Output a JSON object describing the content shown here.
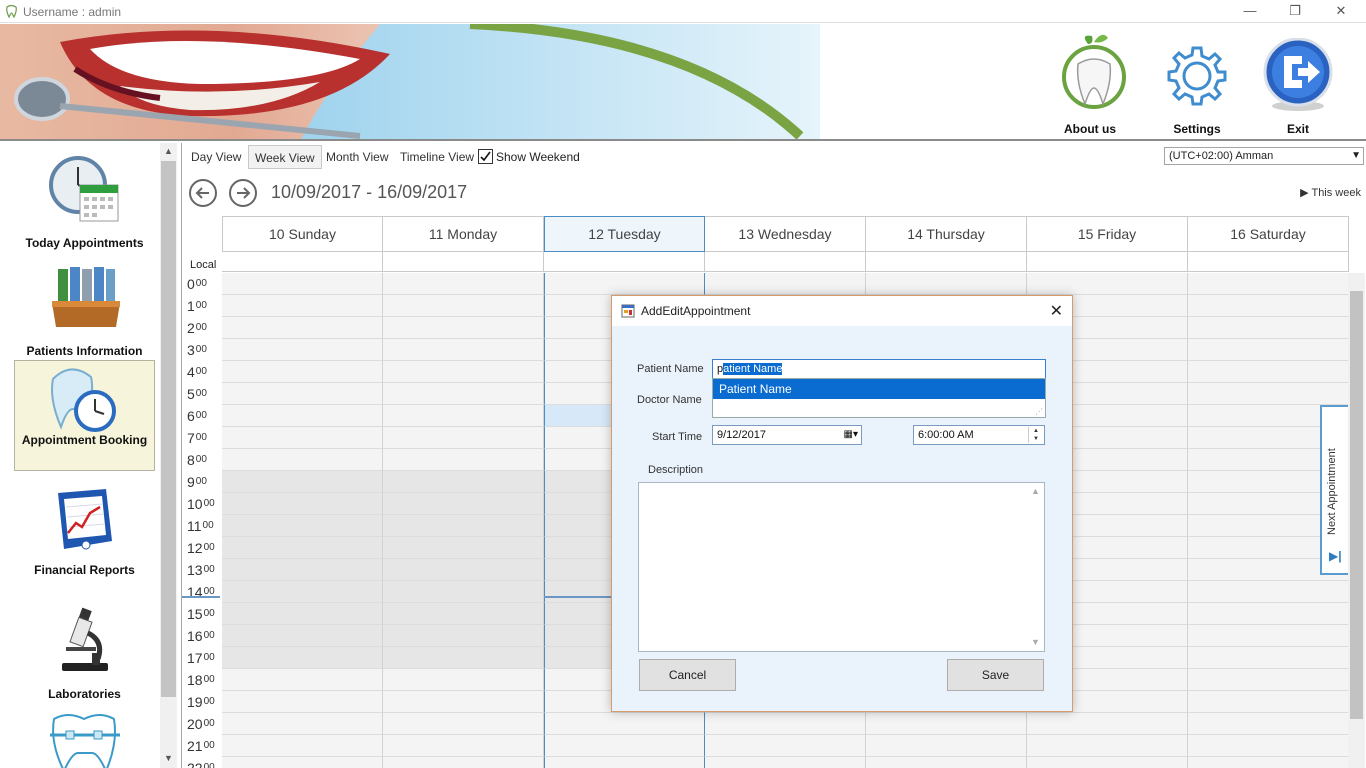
{
  "window": {
    "title": "Username : admin",
    "controls": [
      "—",
      "❐",
      "✕"
    ]
  },
  "header": {
    "buttons": [
      {
        "id": "about",
        "label": "About us",
        "icon": "tooth-leaf-icon"
      },
      {
        "id": "settings",
        "label": "Settings",
        "icon": "gear-icon"
      },
      {
        "id": "exit",
        "label": "Exit",
        "icon": "exit-icon"
      }
    ]
  },
  "sidebar": {
    "items": [
      {
        "label": "Today Appointments",
        "icon": "clock-calendar-icon"
      },
      {
        "label": "Patients Information",
        "icon": "binders-icon"
      },
      {
        "label": "Appointment Booking",
        "icon": "tooth-clock-icon",
        "active": true
      },
      {
        "label": "Financial Reports",
        "icon": "chart-book-icon"
      },
      {
        "label": "Laboratories",
        "icon": "microscope-icon"
      },
      {
        "label": "",
        "icon": "braces-tooth-icon"
      }
    ]
  },
  "scheduler": {
    "views": [
      "Day View",
      "Week View",
      "Month View",
      "Timeline View"
    ],
    "active_view": "Week View",
    "show_weekend_label": "Show Weekend",
    "show_weekend_checked": true,
    "timezone": "(UTC+02:00) Amman",
    "date_range": "10/09/2017 - 16/09/2017",
    "this_week_label": "▶ This week",
    "local_label": "Local",
    "days": [
      "10 Sunday",
      "11 Monday",
      "12 Tuesday",
      "13 Wednesday",
      "14 Thursday",
      "15 Friday",
      "16 Saturday"
    ],
    "today_index": 2,
    "hours": [
      "0",
      "1",
      "2",
      "3",
      "4",
      "5",
      "6",
      "7",
      "8",
      "9",
      "10",
      "11",
      "12",
      "13",
      "14",
      "15",
      "16",
      "17",
      "18",
      "19",
      "20",
      "21",
      "22"
    ],
    "minutes": "00",
    "next_appointment_label": "Next Appointment",
    "colors": {
      "accent": "#4a8cc4",
      "selected": "#d7e9f8"
    }
  },
  "dialog": {
    "title": "AddEditAppointment",
    "patient_label": "Patient Name",
    "patient_value_typed": "p",
    "patient_value_suggest": "atient   Name",
    "autocomplete_option": "Patient   Name",
    "doctor_label": "Doctor Name",
    "start_label": "Start Time",
    "start_date": "9/12/2017",
    "start_time": "6:00:00 AM",
    "description_label": "Description",
    "cancel": "Cancel",
    "save": "Save"
  }
}
